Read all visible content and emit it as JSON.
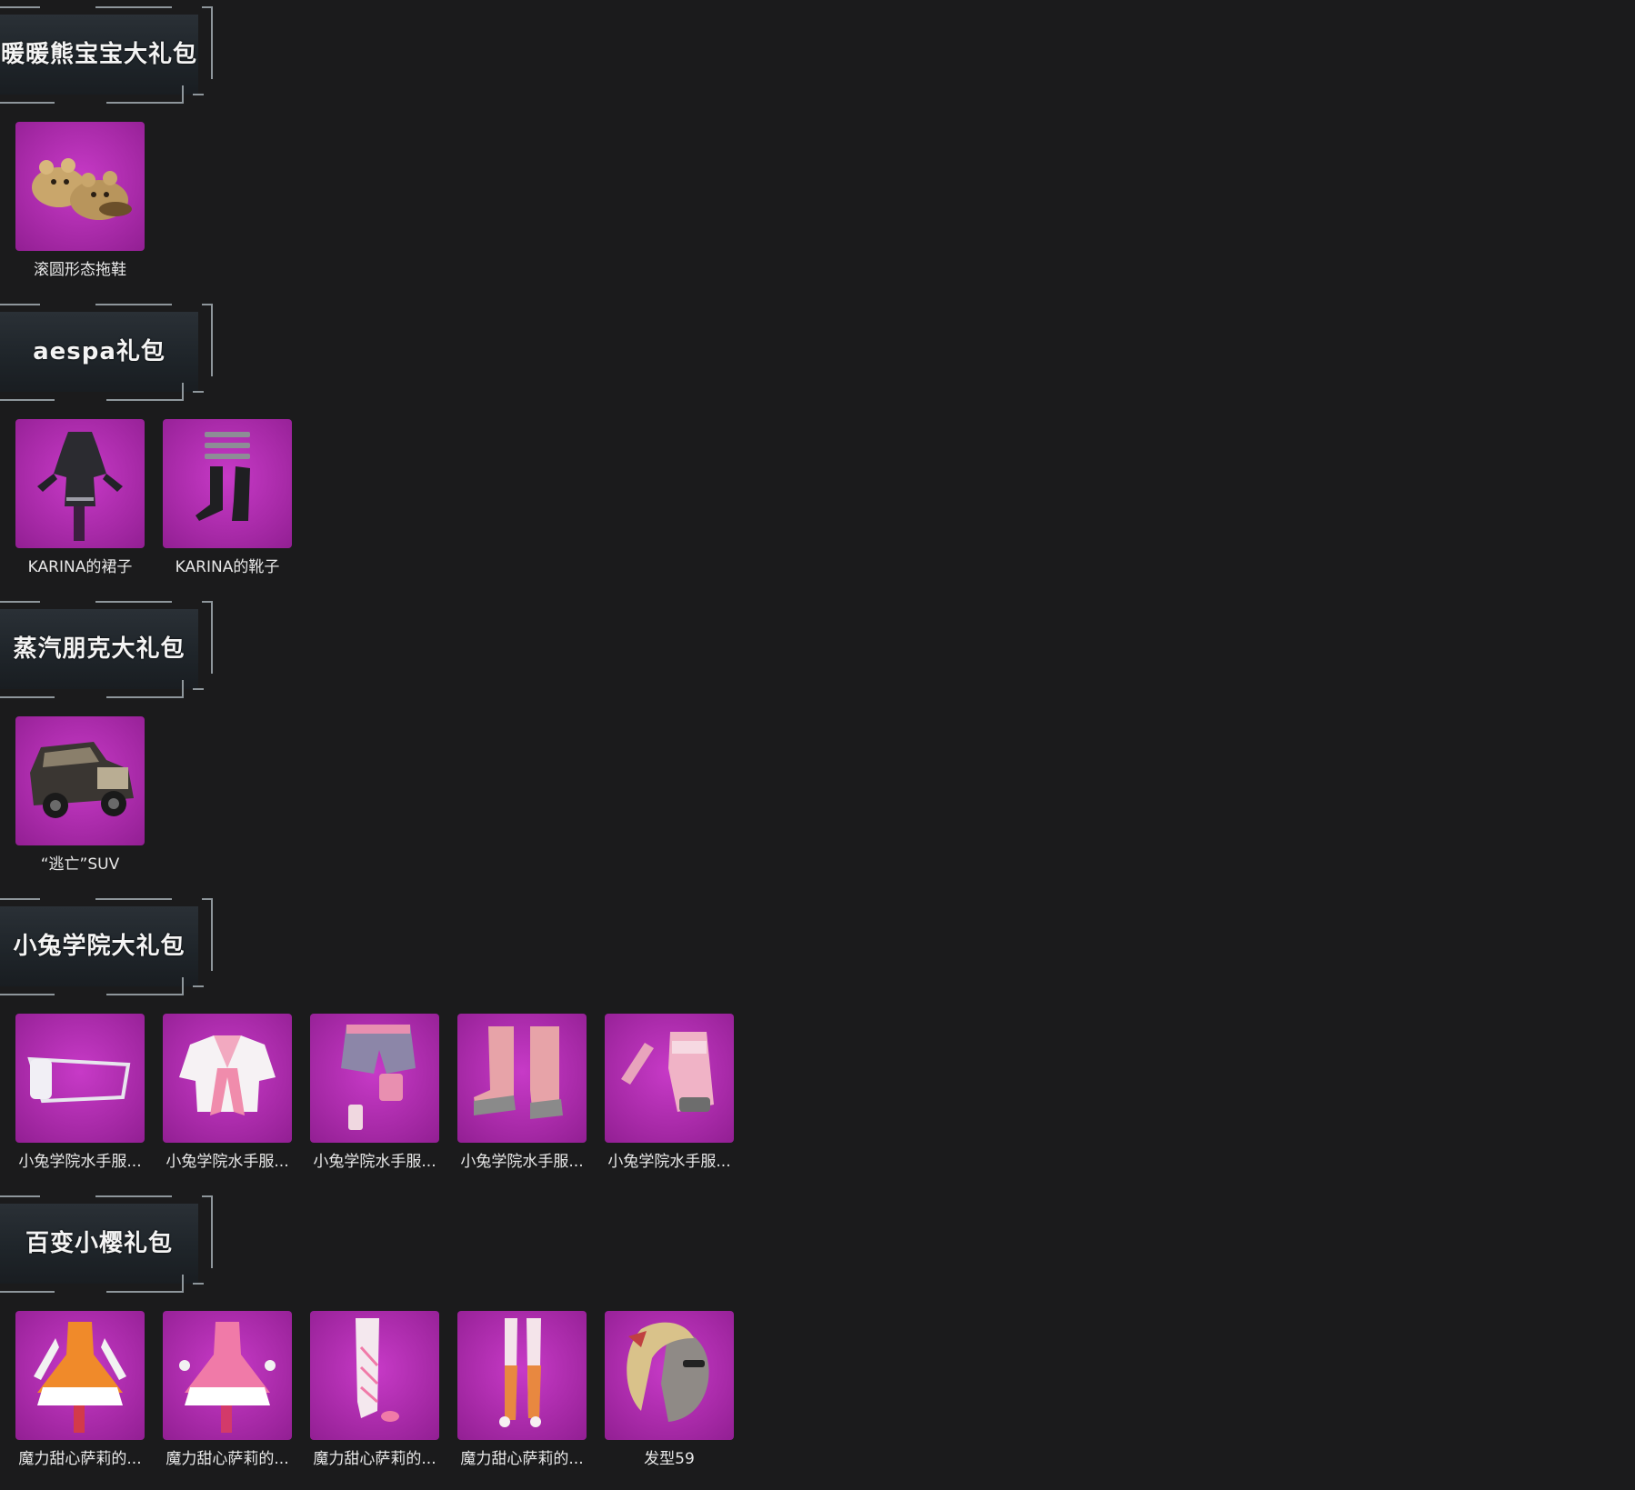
{
  "packs": [
    {
      "title": "暖暖熊宝宝大礼包",
      "items": [
        {
          "name": "滚圆形态拖鞋",
          "icon": "bear-slippers-icon"
        }
      ]
    },
    {
      "title": "aespa礼包",
      "items": [
        {
          "name": "KARINA的裙子",
          "icon": "black-dress-icon"
        },
        {
          "name": "KARINA的靴子",
          "icon": "black-boots-icon"
        }
      ]
    },
    {
      "title": "蒸汽朋克大礼包",
      "items": [
        {
          "name": "“逃亡”SUV",
          "icon": "vintage-car-icon"
        }
      ]
    },
    {
      "title": "小兔学院大礼包",
      "items": [
        {
          "name": "小兔学院水手服...",
          "icon": "face-mask-icon"
        },
        {
          "name": "小兔学院水手服...",
          "icon": "sailor-top-icon"
        },
        {
          "name": "小兔学院水手服...",
          "icon": "shorts-icon"
        },
        {
          "name": "小兔学院水手服...",
          "icon": "pink-boots-icon"
        },
        {
          "name": "小兔学院水手服...",
          "icon": "gloves-icon"
        }
      ]
    },
    {
      "title": "百变小樱礼包",
      "items": [
        {
          "name": "魔力甜心萨莉的...",
          "icon": "orange-dress-icon"
        },
        {
          "name": "魔力甜心萨莉的...",
          "icon": "pink-dress-icon"
        },
        {
          "name": "魔力甜心萨莉的...",
          "icon": "white-stockings-icon"
        },
        {
          "name": "魔力甜心萨莉的...",
          "icon": "orange-stockings-icon"
        },
        {
          "name": "发型59",
          "icon": "hairstyle-icon"
        }
      ]
    }
  ],
  "colors": {
    "background": "#1b1b1c",
    "tile": "#b02fb0",
    "header_plate": "#22282d",
    "header_line": "#8e969b",
    "text": "#e8e8e8"
  }
}
